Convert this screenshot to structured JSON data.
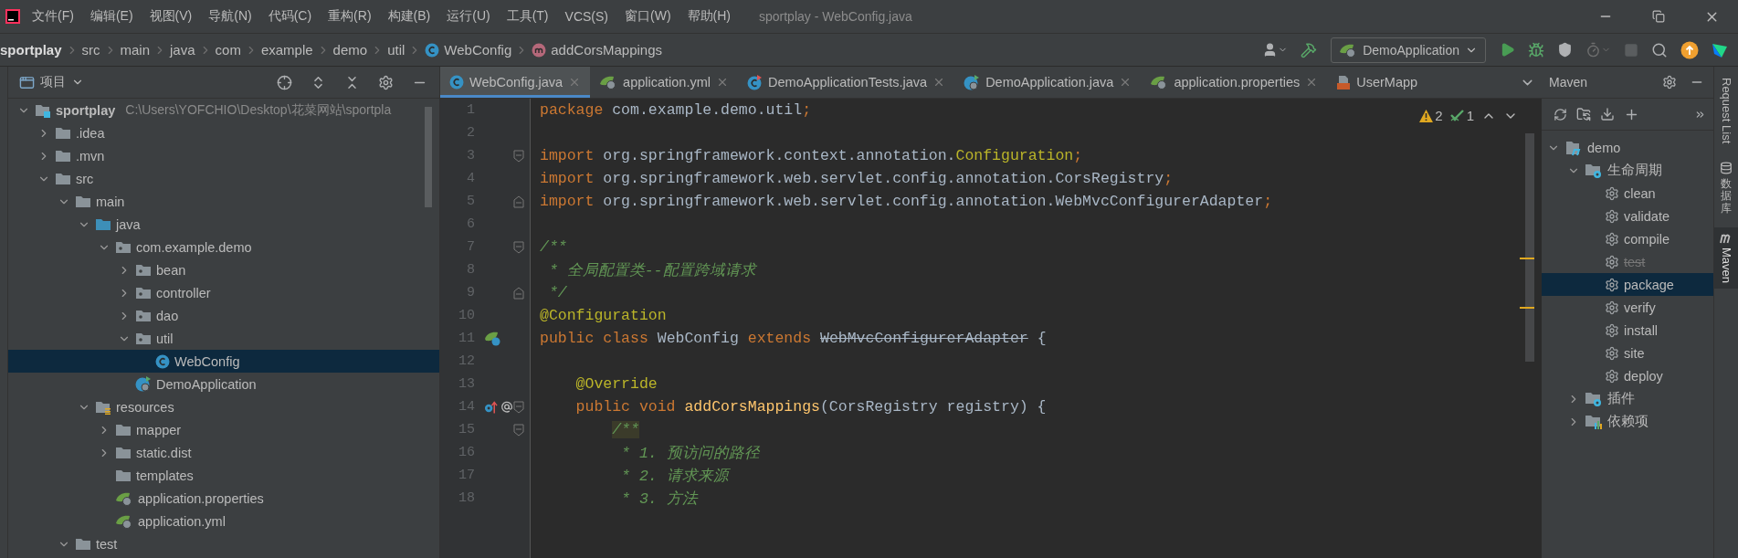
{
  "menu_bar": {
    "items": [
      "文件(F)",
      "编辑(E)",
      "视图(V)",
      "导航(N)",
      "代码(C)",
      "重构(R)",
      "构建(B)",
      "运行(U)",
      "工具(T)",
      "VCS(S)",
      "窗口(W)",
      "帮助(H)"
    ],
    "title": "sportplay - WebConfig.java"
  },
  "breadcrumb": [
    {
      "label": "sportplay",
      "kind": "root"
    },
    {
      "label": "src",
      "kind": "plain"
    },
    {
      "label": "main",
      "kind": "plain"
    },
    {
      "label": "java",
      "kind": "plain"
    },
    {
      "label": "com",
      "kind": "plain"
    },
    {
      "label": "example",
      "kind": "plain"
    },
    {
      "label": "demo",
      "kind": "plain"
    },
    {
      "label": "util",
      "kind": "plain"
    },
    {
      "label": "WebConfig",
      "kind": "class"
    },
    {
      "label": "addCorsMappings",
      "kind": "method"
    }
  ],
  "run_config": {
    "label": "DemoApplication"
  },
  "project_panel": {
    "title": "项目",
    "tree": [
      {
        "name": "sportplay",
        "path": "C:\\Users\\YOFCHIO\\Desktop\\花菜网站\\sportpla",
        "kind": "module",
        "expanded": true,
        "selected": false,
        "children": [
          {
            "name": ".idea",
            "kind": "folder",
            "expanded": false,
            "selected": false
          },
          {
            "name": ".mvn",
            "kind": "folder",
            "expanded": false,
            "selected": false
          },
          {
            "name": "src",
            "kind": "folder",
            "expanded": true,
            "selected": false,
            "children": [
              {
                "name": "main",
                "kind": "folder",
                "expanded": true,
                "selected": false,
                "children": [
                  {
                    "name": "java",
                    "kind": "source",
                    "expanded": true,
                    "selected": false,
                    "children": [
                      {
                        "name": "com.example.demo",
                        "kind": "package",
                        "expanded": true,
                        "selected": false,
                        "children": [
                          {
                            "name": "bean",
                            "kind": "package",
                            "expanded": false,
                            "selected": false
                          },
                          {
                            "name": "controller",
                            "kind": "package",
                            "expanded": false,
                            "selected": false
                          },
                          {
                            "name": "dao",
                            "kind": "package",
                            "expanded": false,
                            "selected": false
                          },
                          {
                            "name": "util",
                            "kind": "package",
                            "expanded": true,
                            "selected": false,
                            "children": [
                              {
                                "name": "WebConfig",
                                "kind": "class",
                                "selected": true
                              }
                            ]
                          },
                          {
                            "name": "DemoApplication",
                            "kind": "app",
                            "selected": false
                          }
                        ]
                      }
                    ]
                  },
                  {
                    "name": "resources",
                    "kind": "resources",
                    "expanded": true,
                    "selected": false,
                    "children": [
                      {
                        "name": "mapper",
                        "kind": "folder",
                        "expanded": false,
                        "selected": false
                      },
                      {
                        "name": "static.dist",
                        "kind": "folder",
                        "expanded": false,
                        "selected": false
                      },
                      {
                        "name": "templates",
                        "kind": "folder",
                        "selected": false
                      },
                      {
                        "name": "application.properties",
                        "kind": "spring",
                        "selected": false
                      },
                      {
                        "name": "application.yml",
                        "kind": "spring",
                        "selected": false
                      }
                    ]
                  }
                ]
              },
              {
                "name": "test",
                "kind": "folder",
                "expanded": true,
                "selected": false
              }
            ]
          }
        ]
      }
    ]
  },
  "editor_tabs": [
    {
      "label": "WebConfig.java",
      "kind": "class",
      "selected": true
    },
    {
      "label": "application.yml",
      "kind": "spring",
      "selected": false
    },
    {
      "label": "DemoApplicationTests.java",
      "kind": "test",
      "selected": false
    },
    {
      "label": "DemoApplication.java",
      "kind": "app",
      "selected": false
    },
    {
      "label": "application.properties",
      "kind": "spring",
      "selected": false
    },
    {
      "label": "UserMapp",
      "kind": "xml",
      "selected": false
    }
  ],
  "inspections": {
    "warnings": "2",
    "passed": "1"
  },
  "code_lines": [
    {
      "number": "1",
      "tokens": [
        {
          "kind": "keyword",
          "text": "package "
        },
        {
          "kind": "plain",
          "text": "com.example.demo.util"
        },
        {
          "kind": "keyword",
          "text": ";"
        }
      ]
    },
    {
      "number": "2"
    },
    {
      "number": "3",
      "markers": [
        {
          "kind": "fold-start"
        }
      ],
      "tokens": [
        {
          "kind": "keyword",
          "text": "import "
        },
        {
          "kind": "plain",
          "text": "org.springframework.context.annotation."
        },
        {
          "kind": "annotation",
          "text": "Configuration"
        },
        {
          "kind": "keyword",
          "text": ";"
        }
      ]
    },
    {
      "number": "4",
      "tokens": [
        {
          "kind": "keyword",
          "text": "import "
        },
        {
          "kind": "plain",
          "text": "org.springframework.web.servlet.config.annotation.CorsRegistry"
        },
        {
          "kind": "keyword",
          "text": ";"
        }
      ]
    },
    {
      "number": "5",
      "markers": [
        {
          "kind": "fold-end"
        }
      ],
      "tokens": [
        {
          "kind": "keyword",
          "text": "import "
        },
        {
          "kind": "plain",
          "text": "org.springframework.web.servlet.config.annotation.WebMvcConfigurerAdapter"
        },
        {
          "kind": "keyword",
          "text": ";"
        }
      ]
    },
    {
      "number": "6"
    },
    {
      "number": "7",
      "markers": [
        {
          "kind": "fold-start"
        }
      ],
      "tokens": [
        {
          "kind": "comment",
          "text": "/**"
        }
      ]
    },
    {
      "number": "8",
      "tokens": [
        {
          "kind": "comment",
          "text": " * 全局配置类--配置跨域请求"
        }
      ]
    },
    {
      "number": "9",
      "markers": [
        {
          "kind": "fold-end"
        }
      ],
      "tokens": [
        {
          "kind": "comment",
          "text": " */"
        }
      ]
    },
    {
      "number": "10",
      "tokens": [
        {
          "kind": "annotation",
          "text": "@Configuration"
        }
      ]
    },
    {
      "number": "11",
      "markers": [
        {
          "kind": "bean"
        }
      ],
      "tokens": [
        {
          "kind": "keyword",
          "text": "public class "
        },
        {
          "kind": "plain",
          "text": "WebConfig "
        },
        {
          "kind": "keyword",
          "text": "extends "
        },
        {
          "kind": "deprecated",
          "text": "WebMvcConfigurerAdapter"
        },
        {
          "kind": "plain",
          "text": " {"
        }
      ]
    },
    {
      "number": "12"
    },
    {
      "number": "13",
      "kind": "body",
      "tokens": [
        {
          "kind": "annotation",
          "text": "@Override"
        }
      ]
    },
    {
      "number": "14",
      "kind": "body",
      "markers": [
        {
          "kind": "override"
        },
        {
          "kind": "fold-start"
        }
      ],
      "tokens": [
        {
          "kind": "keyword",
          "text": "public void "
        },
        {
          "kind": "method",
          "text": "addCorsMappings"
        },
        {
          "kind": "plain",
          "text": "(CorsRegistry registry) {"
        }
      ]
    },
    {
      "number": "15",
      "kind": "inner",
      "markers": [
        {
          "kind": "fold-start"
        }
      ],
      "tokens": [
        {
          "kind": "comment",
          "text": "/**",
          "highlighted": true
        }
      ]
    },
    {
      "number": "16",
      "kind": "inner",
      "tokens": [
        {
          "kind": "comment",
          "text": " * 1. 预访问的路径"
        }
      ]
    },
    {
      "number": "17",
      "kind": "inner",
      "tokens": [
        {
          "kind": "comment",
          "text": " * 2. 请求来源"
        }
      ]
    },
    {
      "number": "18",
      "kind": "inner",
      "tokens": [
        {
          "kind": "comment",
          "text": " * 3. 方法"
        }
      ]
    }
  ],
  "maven_panel": {
    "title": "Maven",
    "tree": [
      {
        "name": "demo",
        "kind": "maven",
        "expanded": true,
        "selected": false,
        "children": [
          {
            "name": "生命周期",
            "kind": "lifecycle",
            "expanded": true,
            "selected": false,
            "children": [
              {
                "name": "clean",
                "kind": "goal",
                "selected": false,
                "skipped": false
              },
              {
                "name": "validate",
                "kind": "goal",
                "selected": false,
                "skipped": false
              },
              {
                "name": "compile",
                "kind": "goal",
                "selected": false,
                "skipped": false
              },
              {
                "name": "test",
                "kind": "goal",
                "selected": false,
                "skipped": true
              },
              {
                "name": "package",
                "kind": "goal",
                "selected": true,
                "skipped": false
              },
              {
                "name": "verify",
                "kind": "goal",
                "selected": false,
                "skipped": false
              },
              {
                "name": "install",
                "kind": "goal",
                "selected": false,
                "skipped": false
              },
              {
                "name": "site",
                "kind": "goal",
                "selected": false,
                "skipped": false
              },
              {
                "name": "deploy",
                "kind": "goal",
                "selected": false,
                "skipped": false
              }
            ]
          },
          {
            "name": "插件",
            "kind": "lifecycle",
            "expanded": false,
            "selected": false
          },
          {
            "name": "依赖项",
            "kind": "deps",
            "expanded": false,
            "selected": false
          }
        ]
      }
    ]
  },
  "side_strip": [
    {
      "label": "Request List",
      "kind": "latin",
      "selected": false
    },
    {
      "label": "数据库",
      "kind": "cjk",
      "selected": false
    },
    {
      "label": "Maven",
      "kind": "latin-maven",
      "selected": true
    }
  ]
}
